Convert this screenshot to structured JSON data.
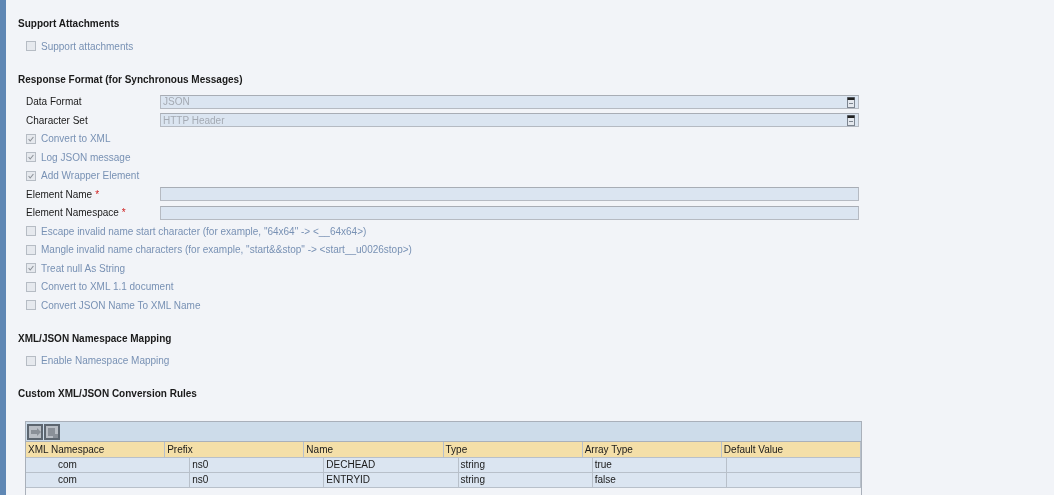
{
  "sections": [
    {
      "title": "Support Attachments",
      "items": [
        {
          "kind": "checkbox",
          "label": "Support attachments",
          "checked": false
        }
      ]
    },
    {
      "title": "Response Format (for Synchronous Messages)",
      "items": [
        {
          "kind": "select",
          "label": "Data Format",
          "value": "JSON"
        },
        {
          "kind": "select",
          "label": "Character Set",
          "value": "HTTP Header"
        },
        {
          "kind": "checkbox",
          "label": "Convert to XML",
          "checked": true
        },
        {
          "kind": "checkbox",
          "label": "Log JSON message",
          "checked": true
        },
        {
          "kind": "checkbox",
          "label": "Add Wrapper Element",
          "checked": true
        },
        {
          "kind": "text",
          "label": "Element Name",
          "mark": "*"
        },
        {
          "kind": "text",
          "label": "Element Namespace",
          "mark": "*"
        },
        {
          "kind": "checkbox",
          "label": "Escape invalid name start character (for example, \"64x64\" -> <__64x64>)",
          "checked": false
        },
        {
          "kind": "checkbox",
          "label": "Mangle invalid name characters (for example, \"start&&stop\" -> <start__u0026stop>)",
          "checked": false
        },
        {
          "kind": "checkbox",
          "label": "Treat null As String",
          "checked": true
        },
        {
          "kind": "checkbox",
          "label": "Convert to XML 1.1 document",
          "checked": false
        },
        {
          "kind": "checkbox",
          "label": "Convert JSON Name To XML Name",
          "checked": false
        }
      ]
    },
    {
      "title": "XML/JSON Namespace Mapping",
      "items": [
        {
          "kind": "checkbox",
          "label": "Enable Namespace Mapping",
          "checked": false
        }
      ]
    },
    {
      "title": "Custom XML/JSON Conversion Rules"
    }
  ],
  "table": {
    "columns": [
      "XML Namespace",
      "Prefix",
      "Name",
      "Type",
      "Array Type",
      "Default Value"
    ],
    "rows": [
      [
        "com",
        "ns0",
        "DECHEAD",
        "string",
        "true",
        ""
      ],
      [
        "com",
        "ns0",
        "ENTRYID",
        "string",
        "false",
        ""
      ]
    ]
  }
}
